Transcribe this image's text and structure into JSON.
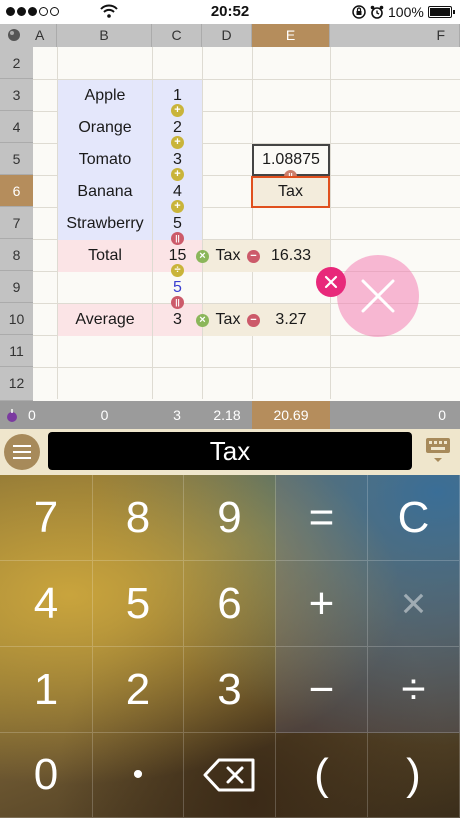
{
  "status": {
    "carrier": "",
    "time": "20:52",
    "battery": "100%"
  },
  "sheet": {
    "columns": [
      "A",
      "B",
      "C",
      "D",
      "E",
      "F"
    ],
    "selected_column": "E",
    "rows": [
      "2",
      "3",
      "4",
      "5",
      "6",
      "7",
      "8",
      "9",
      "10",
      "11",
      "12"
    ],
    "selected_row": "6",
    "items": [
      "Apple",
      "Orange",
      "Tomato",
      "Banana",
      "Strawberry"
    ],
    "values": [
      "1",
      "2",
      "3",
      "4",
      "5"
    ],
    "total_label": "Total",
    "total_value": "15",
    "total_tax_label": "Tax",
    "total_tax_value": "16.33",
    "c9_value": "5",
    "average_label": "Average",
    "average_value": "3",
    "average_tax_label": "Tax",
    "average_tax_value": "3.27",
    "e5_value": "1.08875",
    "e6_value": "Tax",
    "footer": [
      "0",
      "0",
      "3",
      "2.18",
      "20.69",
      "0"
    ]
  },
  "formula": {
    "display": "Tax"
  },
  "keypad": {
    "rows": [
      [
        "7",
        "8",
        "9",
        "=",
        "C"
      ],
      [
        "4",
        "5",
        "6",
        "+",
        "×"
      ],
      [
        "1",
        "2",
        "3",
        "−",
        "÷"
      ],
      [
        "0",
        "•",
        "⌫",
        "(",
        ")"
      ]
    ]
  },
  "colors": {
    "selected_header": "#b58d5c",
    "blue_cells": "#e4e7fb",
    "pink_cells": "#fbe4e6",
    "selection_border": "#e0501e",
    "delete_accent": "#e8287a"
  },
  "icons": {
    "wifi": "wifi-icon",
    "lock": "rotation-lock-icon",
    "alarm": "alarm-icon",
    "battery": "battery-icon",
    "menu": "hamburger-menu-icon",
    "keyboard": "keyboard-icon",
    "delete": "close-icon",
    "backspace": "backspace-icon"
  }
}
